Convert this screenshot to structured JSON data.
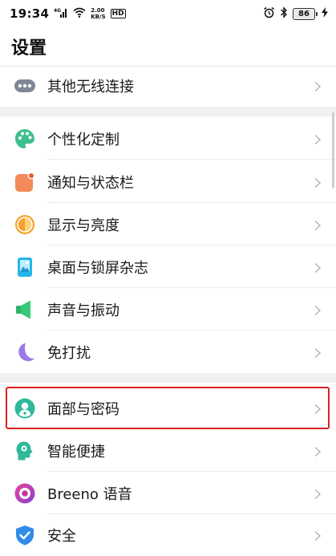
{
  "status_bar": {
    "time": "19:34",
    "network_type": "4G",
    "net_speed_value": "2.00",
    "net_speed_unit": "KB/S",
    "hd": "HD",
    "battery": "86"
  },
  "page_title": "设置",
  "rows": [
    {
      "label": "其他无线连接",
      "icon": "more-dots-icon"
    },
    {
      "label": "个性化定制",
      "icon": "palette-icon"
    },
    {
      "label": "通知与状态栏",
      "icon": "notification-icon"
    },
    {
      "label": "显示与亮度",
      "icon": "brightness-icon"
    },
    {
      "label": "桌面与锁屏杂志",
      "icon": "wallpaper-icon"
    },
    {
      "label": "声音与振动",
      "icon": "speaker-icon"
    },
    {
      "label": "免打扰",
      "icon": "moon-icon"
    },
    {
      "label": "面部与密码",
      "icon": "face-lock-icon"
    },
    {
      "label": "智能便捷",
      "icon": "smart-assist-icon"
    },
    {
      "label": "Breeno 语音",
      "icon": "breeno-icon"
    },
    {
      "label": "安全",
      "icon": "shield-check-icon"
    }
  ],
  "colors": {
    "highlight": "#e02020",
    "section_gap": "#f0f0f0"
  }
}
